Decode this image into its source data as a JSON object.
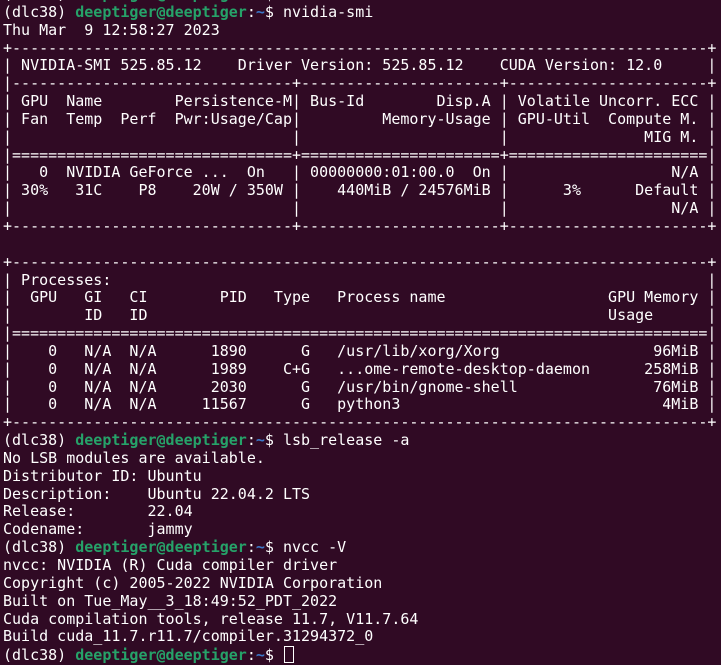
{
  "prompt": {
    "env": "(dlc38) ",
    "user_host": "deeptiger@deeptiger",
    "sep": ":",
    "path": "~",
    "symbol": "$ "
  },
  "lines": [
    {
      "type": "prompt",
      "cmd": ""
    },
    {
      "type": "prompt",
      "cmd": "nvidia-smi"
    },
    {
      "text": "Thu Mar  9 12:58:27 2023"
    },
    {
      "text": "+-----------------------------------------------------------------------------+"
    },
    {
      "text": "| NVIDIA-SMI 525.85.12    Driver Version: 525.85.12    CUDA Version: 12.0     |"
    },
    {
      "text": "|-------------------------------+----------------------+----------------------+"
    },
    {
      "text": "| GPU  Name        Persistence-M| Bus-Id        Disp.A | Volatile Uncorr. ECC |"
    },
    {
      "text": "| Fan  Temp  Perf  Pwr:Usage/Cap|         Memory-Usage | GPU-Util  Compute M. |"
    },
    {
      "text": "|                               |                      |               MIG M. |"
    },
    {
      "text": "|===============================+======================+======================|"
    },
    {
      "text": "|   0  NVIDIA GeForce ...  On   | 00000000:01:00.0  On |                  N/A |"
    },
    {
      "text": "| 30%   31C    P8    20W / 350W |    440MiB / 24576MiB |      3%      Default |"
    },
    {
      "text": "|                               |                      |                  N/A |"
    },
    {
      "text": "+-------------------------------+----------------------+----------------------+"
    },
    {
      "text": ""
    },
    {
      "text": "+-----------------------------------------------------------------------------+"
    },
    {
      "text": "| Processes:                                                                  |"
    },
    {
      "text": "|  GPU   GI   CI        PID   Type   Process name                  GPU Memory |"
    },
    {
      "text": "|        ID   ID                                                   Usage      |"
    },
    {
      "text": "|=============================================================================|"
    },
    {
      "text": "|    0   N/A  N/A      1890      G   /usr/lib/xorg/Xorg                 96MiB |"
    },
    {
      "text": "|    0   N/A  N/A      1989    C+G   ...ome-remote-desktop-daemon      258MiB |"
    },
    {
      "text": "|    0   N/A  N/A      2030      G   /usr/bin/gnome-shell               76MiB |"
    },
    {
      "text": "|    0   N/A  N/A     11567      G   python3                             4MiB |"
    },
    {
      "text": "+-----------------------------------------------------------------------------+"
    },
    {
      "type": "prompt",
      "cmd": "lsb_release -a"
    },
    {
      "text": "No LSB modules are available."
    },
    {
      "text": "Distributor ID:\tUbuntu"
    },
    {
      "text": "Description:\tUbuntu 22.04.2 LTS"
    },
    {
      "text": "Release:\t22.04"
    },
    {
      "text": "Codename:\tjammy"
    },
    {
      "type": "prompt",
      "cmd": "nvcc -V"
    },
    {
      "text": "nvcc: NVIDIA (R) Cuda compiler driver"
    },
    {
      "text": "Copyright (c) 2005-2022 NVIDIA Corporation"
    },
    {
      "text": "Built on Tue_May__3_18:49:52_PDT_2022"
    },
    {
      "text": "Cuda compilation tools, release 11.7, V11.7.64"
    },
    {
      "text": "Build cuda_11.7.r11.7/compiler.31294372_0"
    },
    {
      "type": "prompt",
      "cmd": "",
      "cursor": true
    }
  ]
}
